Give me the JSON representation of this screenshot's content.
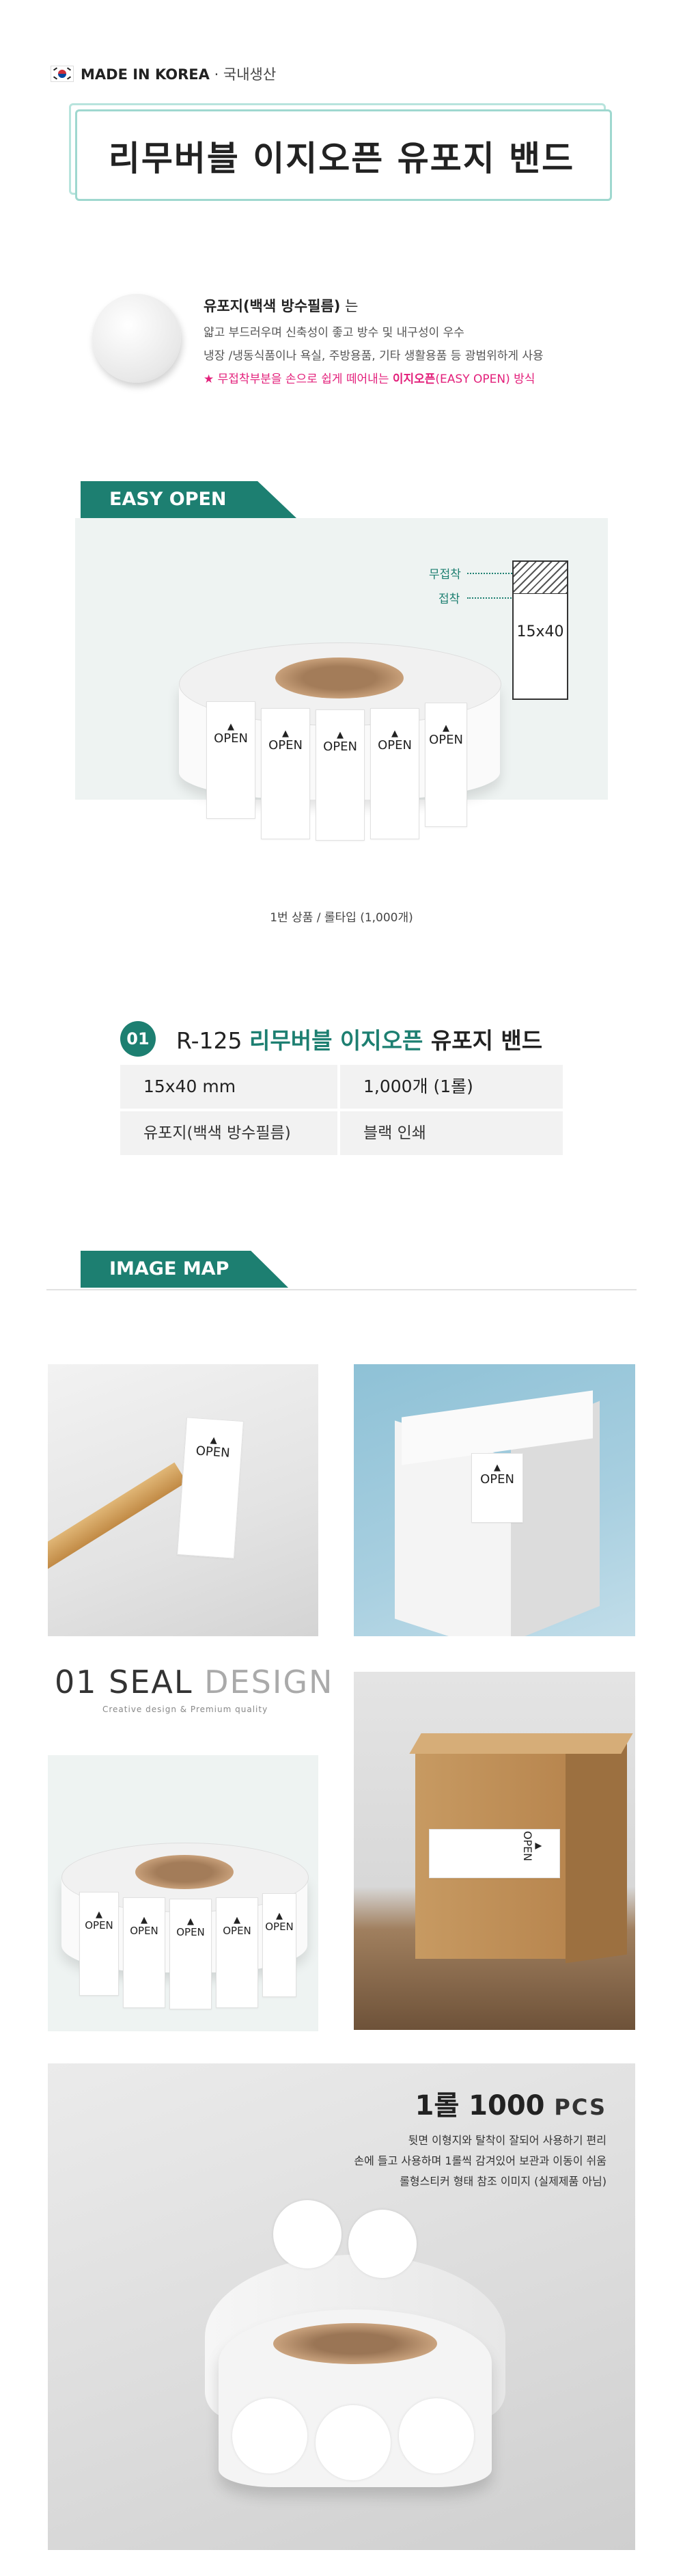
{
  "header": {
    "made_in": "MADE IN KOREA",
    "made_sub": " · 국내생산",
    "title": "리무버블 이지오픈 유포지 밴드"
  },
  "intro": {
    "material_bold": "유포지(백색 방수필름)",
    "material_suffix": " 는",
    "line2": "얇고 부드러우며 신축성이 좋고 방수 및 내구성이 우수",
    "line3": "냉장 /냉동식품이나 욕실, 주방용품, 기타 생활용품 등 광범위하게 사용",
    "line4_prefix": "★ 무접착부분을 손으로 쉽게 떼어내는 ",
    "line4_bold": "이지오픈",
    "line4_suffix": "(EASY OPEN) 방식"
  },
  "easy_open": {
    "tab": "EASY OPEN",
    "no_adhesive": "무접착",
    "adhesive": "접착",
    "size": "15x40",
    "open": "OPEN",
    "caption": "1번 상품 / 롤타입 (1,000개)"
  },
  "product": {
    "number": "01",
    "code": "R-125 ",
    "name_green": "리무버블 이지오픈",
    "name_rest": " 유포지 밴드",
    "size": "15x40 mm",
    "quantity": "1,000개 (1롤)",
    "material": "유포지(백색 방수필름)",
    "print": "블랙 인쇄"
  },
  "image_map": {
    "tab": "IMAGE MAP",
    "open": "OPEN",
    "brand_main": "01 SEAL ",
    "brand_light": "DESIGN",
    "brand_sub": "Creative design & Premium quality",
    "roll_count": "1롤 1000 ",
    "roll_pcs": "PCS",
    "roll_line1": "뒷면 이형지와 탈착이 잘되어 사용하기 편리",
    "roll_line2": "손에 들고 사용하며 1롤씩 감겨있어 보관과 이동이 쉬움",
    "roll_line3": "롤형스티커 형태 참조 이미지 (실제제품 아님)"
  },
  "colors": {
    "accent": "#1d7f71",
    "pink": "#e3207b",
    "title_border": "#9fd8cf"
  }
}
